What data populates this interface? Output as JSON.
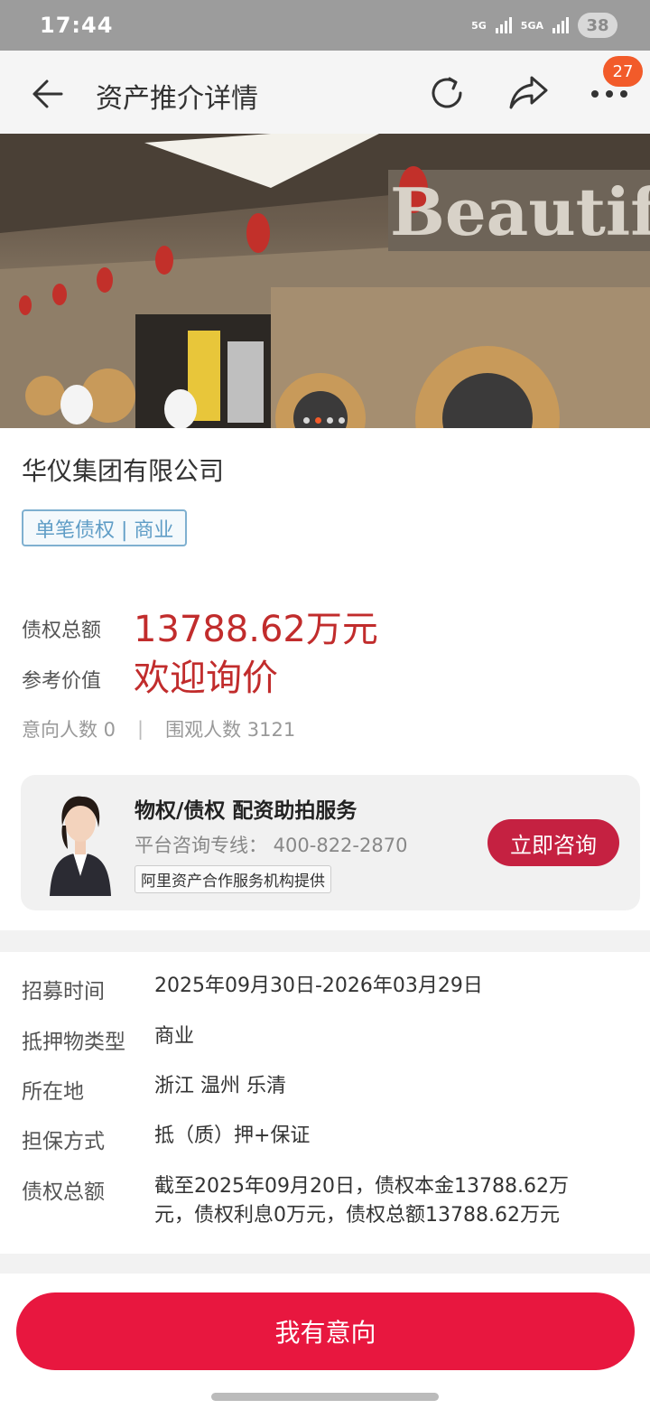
{
  "status": {
    "time": "17:44",
    "net1": "5G",
    "net2": "5GA",
    "battery": "38"
  },
  "nav": {
    "title": "资产推介详情",
    "badge": "27"
  },
  "banner": {
    "sign_text": "Beautif",
    "pages": 4,
    "active_page": 1
  },
  "info": {
    "company": "华仪集团有限公司",
    "tag": "单笔债权 | 商业",
    "total_label": "债权总额",
    "total_value": "13788.62万元",
    "ref_label": "参考价值",
    "ref_value": "欢迎询价",
    "intent_count": "意向人数 0",
    "separator": "|",
    "view_count": "围观人数 3121"
  },
  "consult": {
    "title": "物权/债权  配资助拍服务",
    "phone": "平台咨询专线： 400-822-2870",
    "provider": "阿里资产合作服务机构提供",
    "button": "立即咨询"
  },
  "details": [
    {
      "label": "招募时间",
      "value": "2025年09月30日-2026年03月29日"
    },
    {
      "label": "抵押物类型",
      "value": "商业"
    },
    {
      "label": "所在地",
      "value": "浙江 温州 乐清"
    },
    {
      "label": "担保方式",
      "value": "抵（质）押+保证"
    },
    {
      "label": "债权总额",
      "value": "截至2025年09月20日，债权本金13788.62万元，债权利息0万元，债权总额13788.62万元"
    }
  ],
  "cta": {
    "label": "我有意向"
  },
  "colors": {
    "accent_red": "#c12c2c",
    "cta_red": "#e8173f",
    "tag_blue": "#5f9dc6",
    "badge_orange": "#f25b2a"
  }
}
